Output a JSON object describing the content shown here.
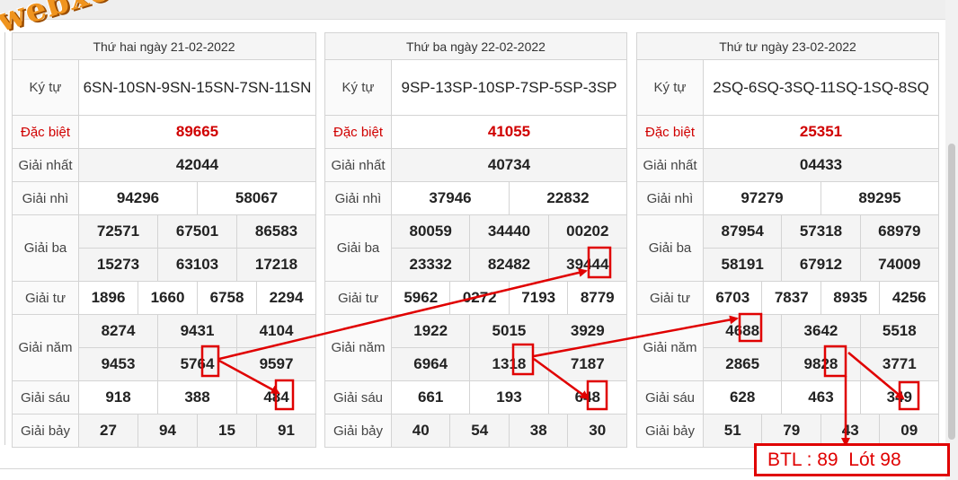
{
  "logo": {
    "text": "webxoso.net"
  },
  "colors": {
    "highlight": "#e00000",
    "special": "#d00000",
    "logo": "#f0941e"
  },
  "labels": {
    "ky_tu": "Ký tự",
    "dac_biet": "Đặc biệt",
    "giai_nhat": "Giải nhất",
    "giai_nhi": "Giải nhì",
    "giai_ba": "Giải ba",
    "giai_tu": "Giải tư",
    "giai_nam": "Giải năm",
    "giai_sau": "Giải sáu",
    "giai_bay": "Giải bảy"
  },
  "tables": [
    {
      "header": "Thứ hai ngày 21-02-2022",
      "ky_tu": "6SN-10SN-9SN-15SN-7SN-11SN",
      "dac_biet": "89665",
      "giai_nhat": "42044",
      "giai_nhi": [
        "94296",
        "58067"
      ],
      "giai_ba": [
        "72571",
        "67501",
        "86583",
        "15273",
        "63103",
        "17218"
      ],
      "giai_tu": [
        "1896",
        "1660",
        "6758",
        "2294"
      ],
      "giai_nam": [
        "8274",
        "9431",
        "4104",
        "9453",
        "5764",
        "9597"
      ],
      "giai_sau": [
        "918",
        "388",
        "484"
      ],
      "giai_bay": [
        "27",
        "94",
        "15",
        "91"
      ]
    },
    {
      "header": "Thứ ba ngày 22-02-2022",
      "ky_tu": "9SP-13SP-10SP-7SP-5SP-3SP",
      "dac_biet": "41055",
      "giai_nhat": "40734",
      "giai_nhi": [
        "37946",
        "22832"
      ],
      "giai_ba": [
        "80059",
        "34440",
        "00202",
        "23332",
        "82482",
        "39444"
      ],
      "giai_tu": [
        "5962",
        "0272",
        "7193",
        "8779"
      ],
      "giai_nam": [
        "1922",
        "5015",
        "3929",
        "6964",
        "1318",
        "7187"
      ],
      "giai_sau": [
        "661",
        "193",
        "648"
      ],
      "giai_bay": [
        "40",
        "54",
        "38",
        "30"
      ]
    },
    {
      "header": "Thứ tư ngày 23-02-2022",
      "ky_tu": "2SQ-6SQ-3SQ-11SQ-1SQ-8SQ",
      "dac_biet": "25351",
      "giai_nhat": "04433",
      "giai_nhi": [
        "97279",
        "89295"
      ],
      "giai_ba": [
        "87954",
        "57318",
        "68979",
        "58191",
        "67912",
        "74009"
      ],
      "giai_tu": [
        "6703",
        "7837",
        "8935",
        "4256"
      ],
      "giai_nam": [
        "4688",
        "3642",
        "5518",
        "2865",
        "9828",
        "3771"
      ],
      "giai_sau": [
        "628",
        "463",
        "349"
      ],
      "giai_bay": [
        "51",
        "79",
        "43",
        "09"
      ]
    }
  ],
  "annotation": {
    "text": "BTL : 89  Lót 98"
  }
}
